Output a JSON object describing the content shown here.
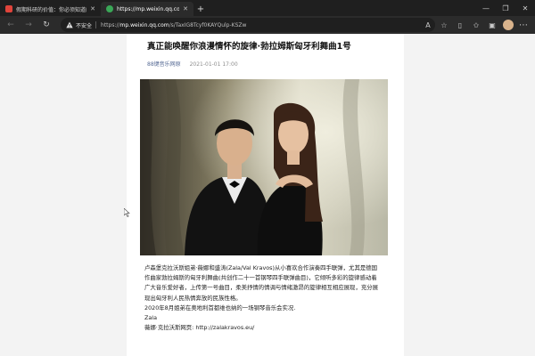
{
  "browser": {
    "tabs": [
      {
        "title": "假期科研的价值：你必须知道的事情",
        "active": false,
        "favicon_color": "#e0443b"
      },
      {
        "title": "https://mp.weixin.qq.com/s/",
        "active": true,
        "favicon_color": "#3aa757"
      }
    ],
    "new_tab_symbol": "+",
    "window_controls": {
      "minimize": "—",
      "maximize": "❐",
      "close": "✕"
    },
    "security_label": "不安全",
    "url_host": "mp.weixin.qq.com",
    "url_prefix": "https://",
    "url_path": "/s/TaxIG8Tcyf0KAYQulp-KSZw"
  },
  "article": {
    "title": "真正能唤醒你浪漫情怀的旋律·勃拉姆斯匈牙利舞曲1号",
    "account": "88键音乐网原",
    "date": "2021-01-01 17:00",
    "paragraphs": [
      "卢森堡克拉沃斯姐弟·薇娜和盛涛(Zala/Val Kravos)从小喜欢合作演奏四手联弹，尤其是德国",
      "作曲家勃拉姆斯的匈牙利舞曲(共创作二十一首钢琴四手联弹曲目)，它倾听多彩的旋律感动着",
      "广大音乐爱好者，上传第一号曲目，柔美抒情的情调与情绪激昂的旋律相互相应展现，充分展",
      "现出匈牙利人民热情奔放的民族性格。",
      "2020年8月姐弟在奥地利首都维也纳的一场钢琴音乐会实况.",
      "Zala",
      "薇娜·克拉沃斯网页:  http://zalakravos.eu/"
    ]
  }
}
